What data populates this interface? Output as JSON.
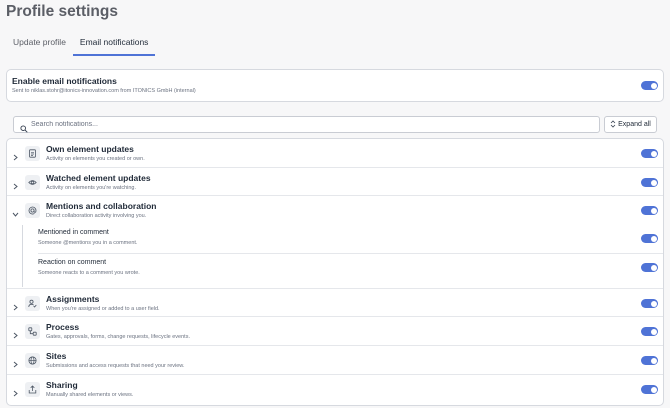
{
  "page": {
    "title": "Profile settings"
  },
  "tabs": [
    {
      "label": "Update profile",
      "active": false
    },
    {
      "label": "Email notifications",
      "active": true
    }
  ],
  "enable": {
    "title": "Enable email notifications",
    "subtitle": "Sent to niklas.stohr@itonics-innovation.com from ITONICS GmbH (internal)",
    "enabled": true
  },
  "search": {
    "placeholder": "Search notifications...",
    "value": ""
  },
  "expand": {
    "label": "Expand all"
  },
  "categories": [
    {
      "title": "Own element updates",
      "subtitle": "Activity on elements you created or own.",
      "icon": "document-icon",
      "enabled": true
    },
    {
      "title": "Watched element updates",
      "subtitle": "Activity on elements you're watching.",
      "icon": "eye-icon",
      "enabled": true
    },
    {
      "title": "Mentions and collaboration",
      "subtitle": "Direct collaboration activity involving you.",
      "icon": "at-sign-icon",
      "enabled": true,
      "expanded": true,
      "children": [
        {
          "title": "Mentioned in comment",
          "subtitle": "Someone @mentions you in a comment.",
          "enabled": true
        },
        {
          "title": "Reaction on comment",
          "subtitle": "Someone reacts to a comment you wrote.",
          "enabled": true
        }
      ]
    },
    {
      "title": "Assignments",
      "subtitle": "When you're assigned or added to a user field.",
      "icon": "user-check-icon",
      "enabled": true
    },
    {
      "title": "Process",
      "subtitle": "Gates, approvals, forms, change requests, lifecycle events.",
      "icon": "workflow-icon",
      "enabled": true
    },
    {
      "title": "Sites",
      "subtitle": "Submissions and access requests that need your review.",
      "icon": "globe-icon",
      "enabled": true
    },
    {
      "title": "Sharing",
      "subtitle": "Manually shared elements or views.",
      "icon": "share-icon",
      "enabled": true
    }
  ],
  "colors": {
    "accent": "#4f73d6",
    "background": "#f7f7f8",
    "card": "#ffffff",
    "muted_text": "#6b7280"
  }
}
